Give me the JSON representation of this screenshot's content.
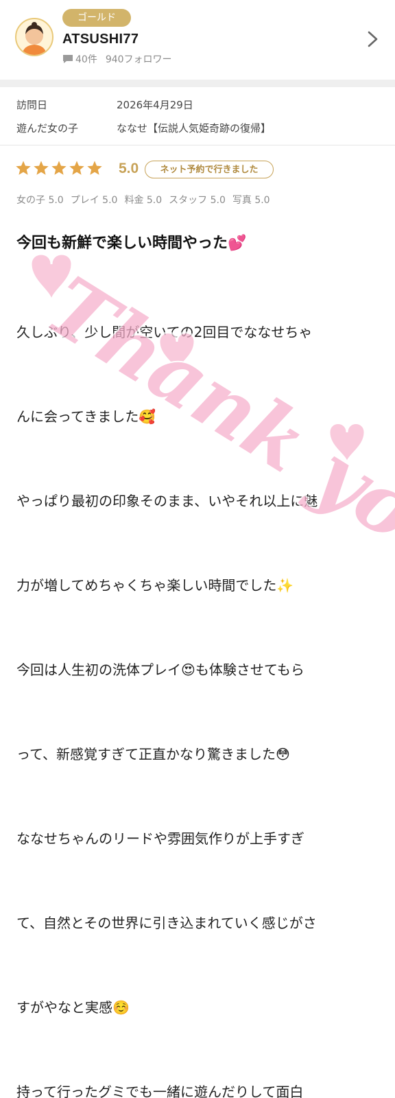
{
  "user": {
    "badge": "ゴールド",
    "name": "ATSUSHI77",
    "posts": "40件",
    "followers": "940フォロワー"
  },
  "visit": {
    "date_label": "訪問日",
    "date_value": "2026年4月29日",
    "girl_label": "遊んだ女の子",
    "girl_value": "ななせ【伝説人気姫奇跡の復帰】"
  },
  "rating": {
    "stars": 5,
    "score": "5.0",
    "reservation_badge": "ネット予約で行きました",
    "subscores": [
      "女の子 5.0",
      "プレイ 5.0",
      "料金 5.0",
      "スタッフ 5.0",
      "写真 5.0"
    ]
  },
  "review": {
    "title": "今回も新鮮で楽しい時間やった💕",
    "lines": [
      "久しぶり、少し間が空いての2回目でななせちゃ",
      "んに会ってきました🥰",
      "やっぱり最初の印象そのまま、いやそれ以上に魅",
      "力が増してめちゃくちゃ楽しい時間でした✨",
      "今回は人生初の洗体プレイ😍も体験させてもら",
      "って、新感覚すぎて正直かなり驚きました😳",
      "ななせちゃんのリードや雰囲気作りが上手すぎ",
      "て、自然とその世界に引き込まれていく感じがさ",
      "すがやなと実感☺️",
      "持って行ったグミでも一緒に遊んだりして面白"
    ]
  },
  "watermark": {
    "text": "Thank you"
  },
  "colors": {
    "gold": "#c7a257",
    "badge_bg": "#d2b46a",
    "pink": "#f4a6c4"
  },
  "icons": [
    "avatar",
    "comment-icon",
    "chevron-right-icon",
    "star-icon",
    "heart-icon"
  ]
}
